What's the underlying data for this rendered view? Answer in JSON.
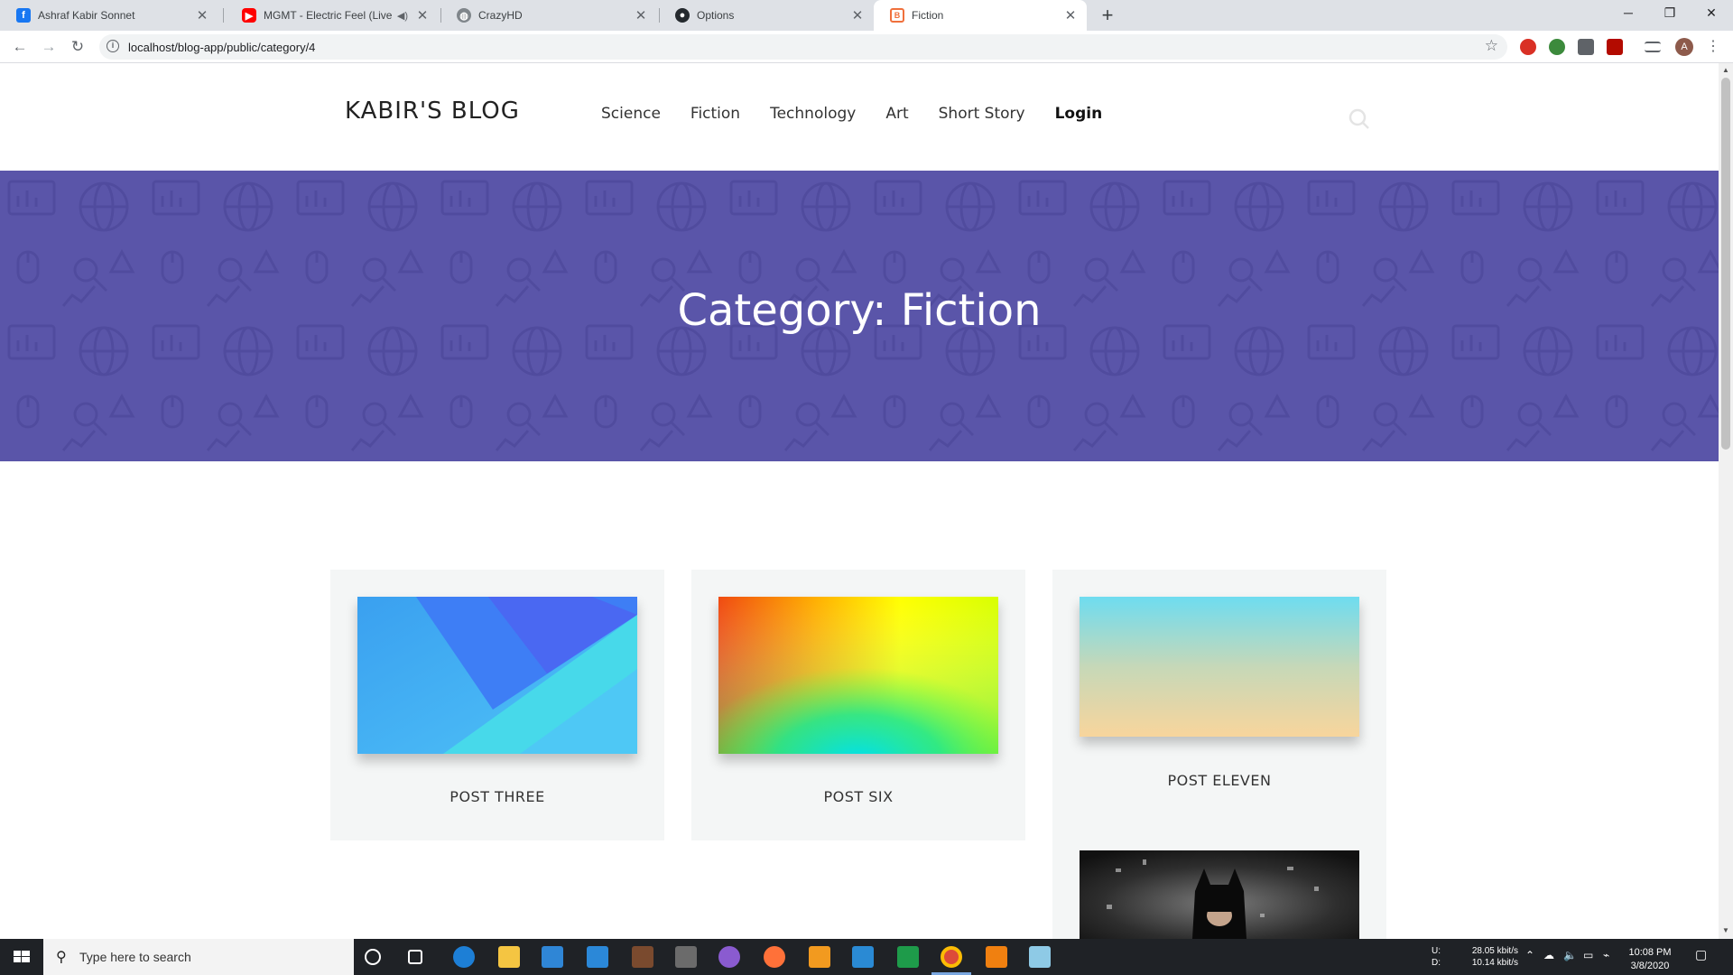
{
  "browser": {
    "tabs": [
      {
        "title": "Ashraf Kabir Sonnet",
        "favicon": "facebook-icon",
        "color": "#1877f2"
      },
      {
        "title": "MGMT - Electric Feel (Live on",
        "favicon": "youtube-icon",
        "color": "#ff0000"
      },
      {
        "title": "CrazyHD",
        "favicon": "globe-icon",
        "color": "#5f6368"
      },
      {
        "title": "Options",
        "favicon": "github-icon",
        "color": "#24292e"
      },
      {
        "title": "Fiction",
        "favicon": "blog-icon",
        "color": "#f0703c",
        "active": true
      }
    ],
    "url": "localhost/blog-app/public/category/4",
    "profile_initial": "A"
  },
  "site": {
    "logo": "KABIR'S BLOG",
    "menu": [
      "Science",
      "Fiction",
      "Technology",
      "Art",
      "Short Story"
    ],
    "login": "Login",
    "hero_title": "Category: Fiction",
    "hero_color": "#5a55a9",
    "posts": [
      {
        "title": "POST THREE",
        "image": "blue-geometric-gradient"
      },
      {
        "title": "POST SIX",
        "image": "rainbow-gradient"
      },
      {
        "title": "POST ELEVEN",
        "image": "sky-sand-gradient"
      },
      {
        "title": "",
        "image": "batman-photo"
      }
    ]
  },
  "taskbar": {
    "search_placeholder": "Type here to search",
    "net_up_label": "U:",
    "net_down_label": "D:",
    "net_up": "28.05 kbit/s",
    "net_down": "10.14 kbit/s",
    "time": "10:08 PM",
    "date": "3/8/2020"
  }
}
